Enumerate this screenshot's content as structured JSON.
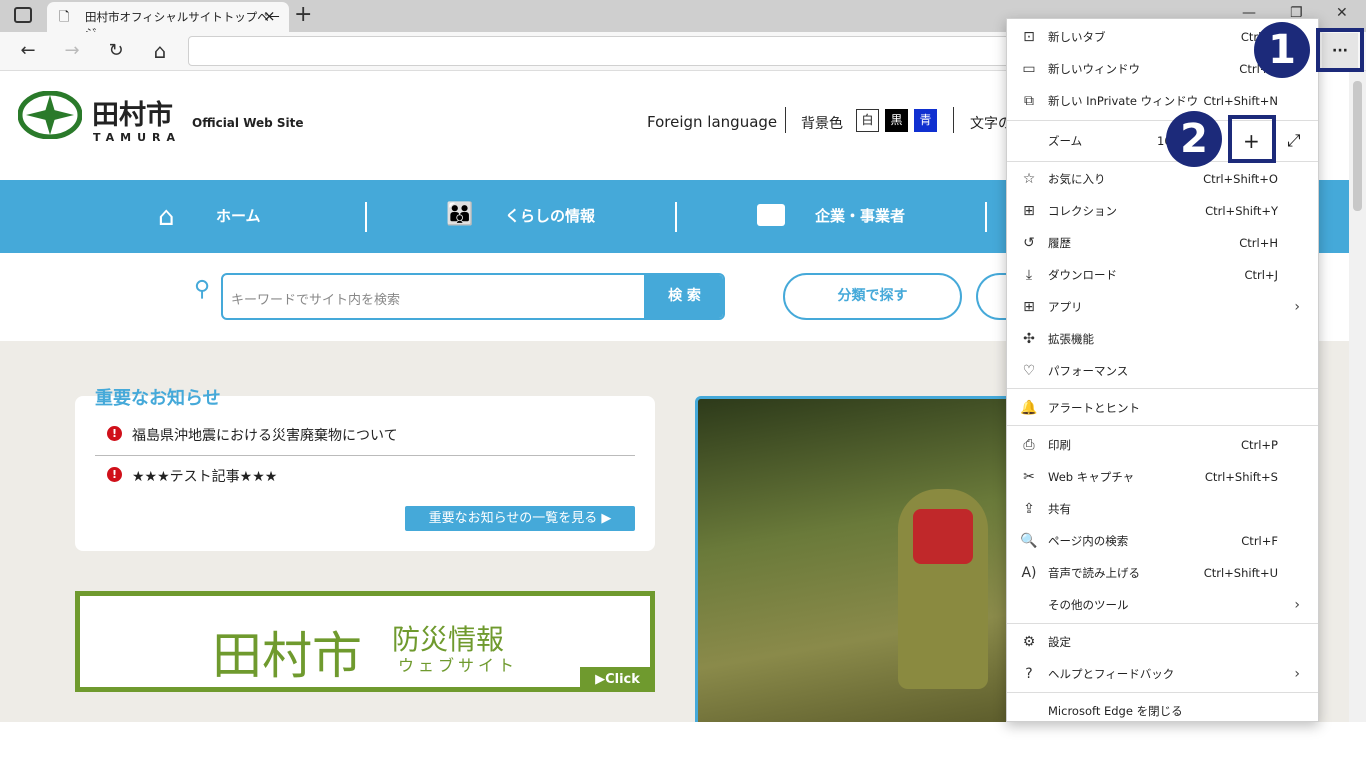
{
  "browser": {
    "tab_title": "田村市オフィシャルサイトトップページ",
    "new_tab_symbol": "+",
    "tab_close": "×",
    "min": "—",
    "restore": "❐",
    "close": "✕",
    "back": "←",
    "forward": "→",
    "refresh": "↻",
    "home": "⌂",
    "more": "···"
  },
  "site": {
    "logo_name": "田村市",
    "logo_roman": "TAMURA",
    "logo_sub": "Official Web Site",
    "foreign_language": "Foreign language",
    "bg_color_label": "背景色",
    "bg_white": "白",
    "bg_black": "黒",
    "bg_blue": "青",
    "text_size_label": "文字の",
    "nav": [
      {
        "label": "ホーム"
      },
      {
        "label": "くらしの情報"
      },
      {
        "label": "企業・事業者"
      }
    ],
    "search_placeholder": "キーワードでサイト内を検索",
    "search_button": "検 索",
    "category_button": "分類で探す",
    "important_title": "重要なお知らせ",
    "notices": [
      "福島県沖地震における災害廃棄物について",
      "★★★テスト記事★★★"
    ],
    "notice_more": "重要なお知らせの一覧を見る ▶",
    "bousai_city": "田村市",
    "bousai_title": "防災情報",
    "bousai_sub": "ウェブサイト",
    "bousai_click": "▶Click"
  },
  "menu": {
    "items_top": [
      {
        "label": "新しいタブ",
        "shortcut": "Ctrl+T",
        "icon": "new-tab-icon"
      },
      {
        "label": "新しいウィンドウ",
        "shortcut": "Ctrl+N",
        "icon": "new-window-icon"
      },
      {
        "label": "新しい InPrivate ウィンドウ",
        "shortcut": "Ctrl+Shift+N",
        "icon": "inprivate-icon"
      }
    ],
    "zoom_label": "ズーム",
    "zoom_value": "100%",
    "zoom_plus": "+",
    "fullscreen": "⤢",
    "items_mid": [
      {
        "label": "お気に入り",
        "shortcut": "Ctrl+Shift+O",
        "icon": "star-icon"
      },
      {
        "label": "コレクション",
        "shortcut": "Ctrl+Shift+Y",
        "icon": "collections-icon"
      },
      {
        "label": "履歴",
        "shortcut": "Ctrl+H",
        "icon": "history-icon"
      },
      {
        "label": "ダウンロード",
        "shortcut": "Ctrl+J",
        "icon": "download-icon"
      },
      {
        "label": "アプリ",
        "shortcut": "",
        "icon": "apps-icon",
        "arrow": true
      },
      {
        "label": "拡張機能",
        "shortcut": "",
        "icon": "extensions-icon"
      },
      {
        "label": "パフォーマンス",
        "shortcut": "",
        "icon": "performance-icon"
      }
    ],
    "alerts": "アラートとヒント",
    "items_tools": [
      {
        "label": "印刷",
        "shortcut": "Ctrl+P",
        "icon": "print-icon"
      },
      {
        "label": "Web キャプチャ",
        "shortcut": "Ctrl+Shift+S",
        "icon": "web-capture-icon"
      },
      {
        "label": "共有",
        "shortcut": "",
        "icon": "share-icon"
      },
      {
        "label": "ページ内の検索",
        "shortcut": "Ctrl+F",
        "icon": "find-icon"
      },
      {
        "label": "音声で読み上げる",
        "shortcut": "Ctrl+Shift+U",
        "icon": "read-aloud-icon"
      },
      {
        "label": "その他のツール",
        "shortcut": "",
        "icon": "",
        "arrow": true
      }
    ],
    "settings": "設定",
    "help": "ヘルプとフィードバック",
    "close_edge": "Microsoft Edge を閉じる"
  },
  "annotations": {
    "step1": "1",
    "step2": "2",
    "color": "#1c2a7a"
  }
}
